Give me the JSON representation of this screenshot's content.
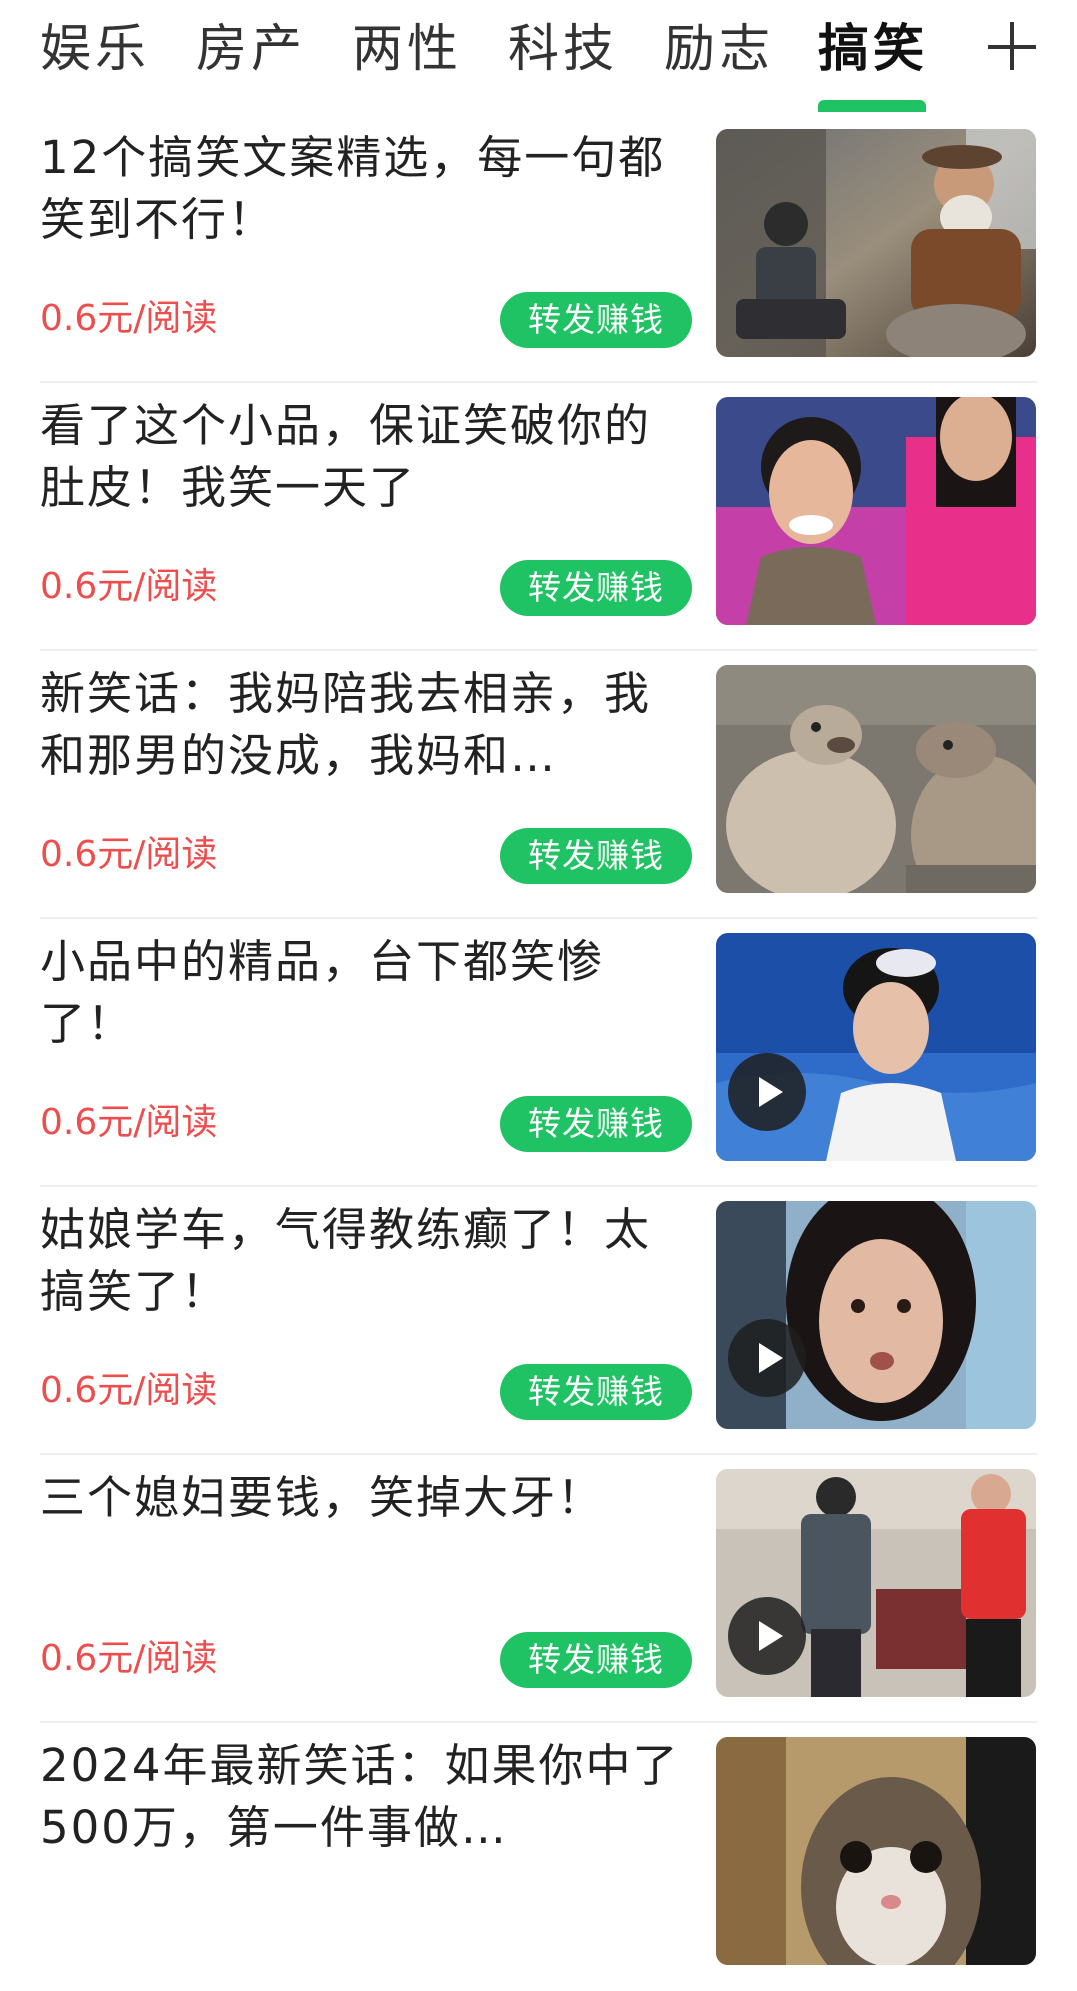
{
  "tabs": [
    {
      "label": "娱乐",
      "active": false
    },
    {
      "label": "房产",
      "active": false
    },
    {
      "label": "两性",
      "active": false
    },
    {
      "label": "科技",
      "active": false
    },
    {
      "label": "励志",
      "active": false
    },
    {
      "label": "搞笑",
      "active": true
    }
  ],
  "add_tab_icon": "plus-icon",
  "colors": {
    "accent": "#1fc364",
    "price": "#ee4d4d",
    "text": "#222222"
  },
  "articles": [
    {
      "title": "12个搞笑文案精选，每一句都笑到不行！",
      "price": "0.6元/阅读",
      "action": "转发赚钱",
      "video": false
    },
    {
      "title": "看了这个小品，保证笑破你的肚皮！我笑一天了",
      "price": "0.6元/阅读",
      "action": "转发赚钱",
      "video": false
    },
    {
      "title": "新笑话：我妈陪我去相亲，我和那男的没成，我妈和…",
      "price": "0.6元/阅读",
      "action": "转发赚钱",
      "video": false
    },
    {
      "title": "小品中的精品，台下都笑惨了！",
      "price": "0.6元/阅读",
      "action": "转发赚钱",
      "video": true
    },
    {
      "title": "姑娘学车，气得教练癫了！太搞笑了！",
      "price": "0.6元/阅读",
      "action": "转发赚钱",
      "video": true
    },
    {
      "title": "三个媳妇要钱，笑掉大牙！",
      "price": "0.6元/阅读",
      "action": "转发赚钱",
      "video": true
    },
    {
      "title": "2024年最新笑话：如果你中了500万，第一件事做…",
      "price": "",
      "action": "",
      "video": false
    }
  ]
}
